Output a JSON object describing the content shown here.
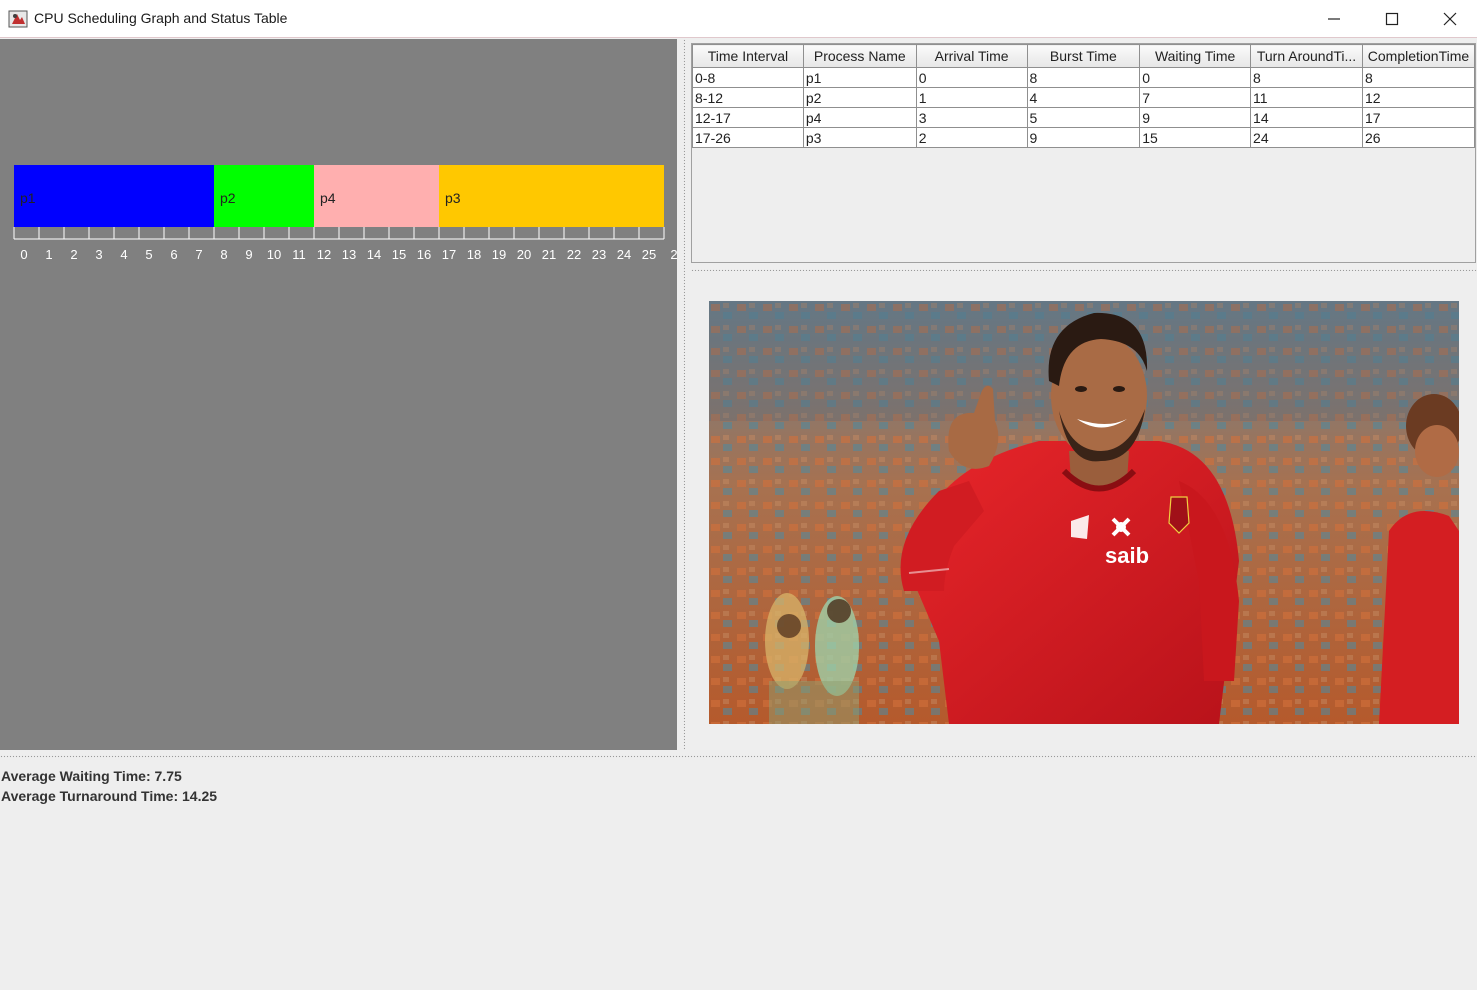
{
  "window": {
    "title": "CPU Scheduling Graph and Status Table",
    "icon": "java-app-icon",
    "controls": [
      "minimize-icon",
      "maximize-icon",
      "close-icon"
    ]
  },
  "chart_data": {
    "type": "bar",
    "subtype": "gantt",
    "segments": [
      {
        "name": "p1",
        "start": 0,
        "end": 8,
        "color": "#0000ff"
      },
      {
        "name": "p2",
        "start": 8,
        "end": 12,
        "color": "#00ff00"
      },
      {
        "name": "p4",
        "start": 12,
        "end": 17,
        "color": "#ffafaf"
      },
      {
        "name": "p3",
        "start": 17,
        "end": 26,
        "color": "#ffc800"
      }
    ],
    "axis_ticks": [
      "0",
      "1",
      "2",
      "3",
      "4",
      "5",
      "6",
      "7",
      "8",
      "9",
      "10",
      "11",
      "12",
      "13",
      "14",
      "15",
      "16",
      "17",
      "18",
      "19",
      "20",
      "21",
      "22",
      "23",
      "24",
      "25",
      "2"
    ],
    "xlim": [
      0,
      26
    ],
    "background": "#808080",
    "grid": false,
    "legend": "none"
  },
  "table": {
    "columns": [
      "Time Interval",
      "Process Name",
      "Arrival Time",
      "Burst Time",
      "Waiting Time",
      "Turn AroundTi...",
      "CompletionTime"
    ],
    "rows": [
      [
        "0-8",
        "p1",
        "0",
        "8",
        "0",
        "8",
        "8"
      ],
      [
        "8-12",
        "p2",
        "1",
        "4",
        "7",
        "11",
        "12"
      ],
      [
        "12-17",
        "p4",
        "3",
        "5",
        "9",
        "14",
        "17"
      ],
      [
        "17-26",
        "p3",
        "2",
        "9",
        "15",
        "24",
        "26"
      ]
    ]
  },
  "photo": {
    "kit_text": "saib"
  },
  "stats": {
    "avg_waiting": "Average Waiting Time: 7.75",
    "avg_turnaround": "Average Turnaround Time: 14.25"
  }
}
